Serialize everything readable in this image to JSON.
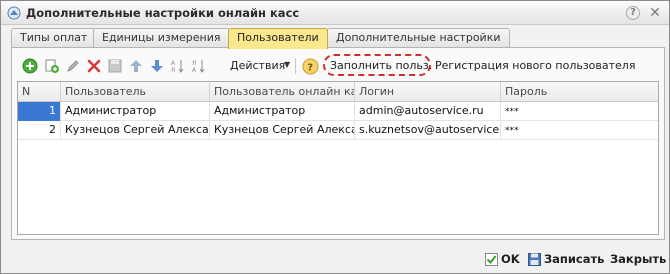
{
  "window": {
    "title": "Дополнительные настройки онлайн касс"
  },
  "tabs": [
    {
      "label": "Типы оплат"
    },
    {
      "label": "Единицы измерения"
    },
    {
      "label": "Пользователи"
    },
    {
      "label": "Дополнительные настройки"
    }
  ],
  "toolbar": {
    "actions_label": "Действия",
    "help_symbol": "?",
    "fill_users_label": "Заполнить польз.",
    "register_user_label": "Регистрация нового пользователя"
  },
  "table": {
    "columns": [
      "N",
      "Пользователь",
      "Пользователь онлайн касс",
      "Логин",
      "Пароль"
    ],
    "rows": [
      {
        "n": "1",
        "user": "Администратор",
        "online_user": "Администратор",
        "login": "admin@autoservice.ru",
        "password": "***"
      },
      {
        "n": "2",
        "user": "Кузнецов Сергей Александрович",
        "online_user": "Кузнецов Сергей Александрович",
        "login": "s.kuznetsov@autoservice.ru",
        "password": "***"
      }
    ]
  },
  "footer": {
    "ok_label": "OK",
    "save_label": "Записать",
    "close_label": "Закрыть"
  },
  "colors": {
    "active_tab": "#fbe88e",
    "selected_cell": "#3b78d4",
    "highlight_dashed": "#d52b2b"
  }
}
